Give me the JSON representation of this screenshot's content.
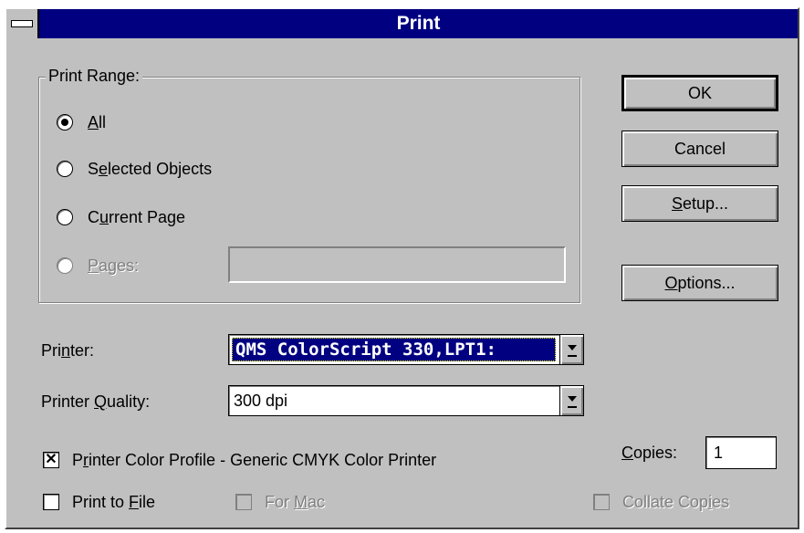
{
  "window": {
    "title": "Print"
  },
  "print_range": {
    "label": "Print Range:",
    "options": [
      {
        "pre": "",
        "key": "A",
        "post": "ll",
        "checked": true,
        "enabled": true
      },
      {
        "pre": "S",
        "key": "e",
        "post": "lected Objects",
        "checked": false,
        "enabled": true
      },
      {
        "pre": "C",
        "key": "u",
        "post": "rrent Page",
        "checked": false,
        "enabled": true
      },
      {
        "pre": "",
        "key": "P",
        "post": "ages:",
        "checked": false,
        "enabled": false
      }
    ],
    "pages_value": ""
  },
  "buttons": {
    "ok": "OK",
    "cancel": "Cancel",
    "setup": {
      "key": "S",
      "rest": "etup..."
    },
    "options": {
      "key": "O",
      "rest": "ptions..."
    }
  },
  "printer": {
    "label": {
      "pre": "Pri",
      "key": "n",
      "post": "ter:"
    },
    "value": "QMS ColorScript 330,LPT1:"
  },
  "quality": {
    "label": {
      "pre": "Printer ",
      "key": "Q",
      "post": "uality:"
    },
    "value": "300 dpi"
  },
  "checkboxes": {
    "color_profile": {
      "pre": "P",
      "key": "r",
      "post": "inter Color Profile - Generic CMYK Color Printer",
      "checked": true,
      "enabled": true
    },
    "print_to_file": {
      "pre": "Print to ",
      "key": "F",
      "post": "ile",
      "checked": false,
      "enabled": true
    },
    "for_mac": {
      "pre": "For ",
      "key": "M",
      "post": "ac",
      "checked": false,
      "enabled": false
    },
    "collate": {
      "pre": "Collate Cop",
      "key": "i",
      "post": "es",
      "checked": false,
      "enabled": false
    }
  },
  "copies": {
    "label": {
      "key": "C",
      "rest": "opies:"
    },
    "value": "1"
  }
}
